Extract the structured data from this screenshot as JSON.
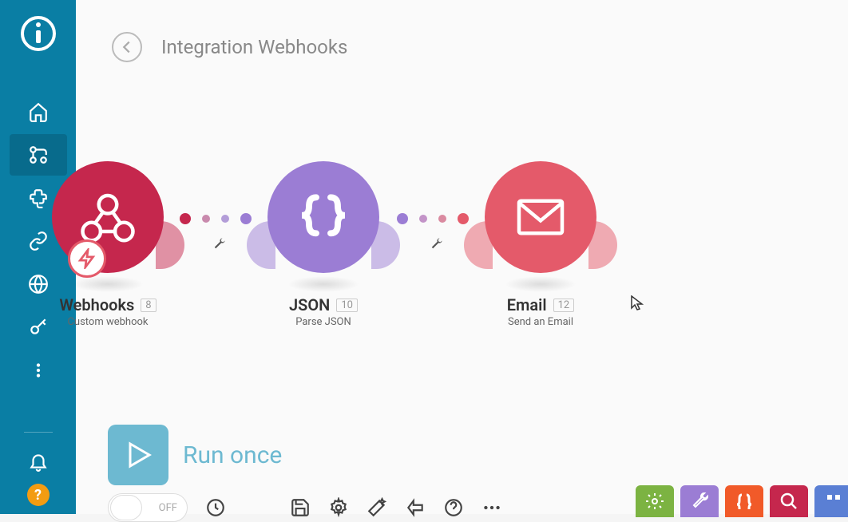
{
  "page_title": "Integration Webhooks",
  "modules": [
    {
      "title": "Webhooks",
      "badge": "8",
      "subtitle": "Custom webhook",
      "color": "#c5274d"
    },
    {
      "title": "JSON",
      "badge": "10",
      "subtitle": "Parse JSON",
      "color": "#9b7dd4"
    },
    {
      "title": "Email",
      "badge": "12",
      "subtitle": "Send an Email",
      "color": "#e45a6a"
    }
  ],
  "run": {
    "label": "Run once"
  },
  "toggle": {
    "state": "OFF"
  },
  "colors": {
    "sidebar": "#0a7ea4",
    "webhooks": "#c5274d",
    "json": "#9b7dd4",
    "email": "#e45a6a",
    "run": "#6db9d1",
    "help": "#f39c12",
    "sq_green": "#7cb342",
    "sq_purple": "#9b7dd4",
    "sq_orange": "#f15a29",
    "sq_red": "#c5274d",
    "sq_blue": "#5a7fd4"
  }
}
